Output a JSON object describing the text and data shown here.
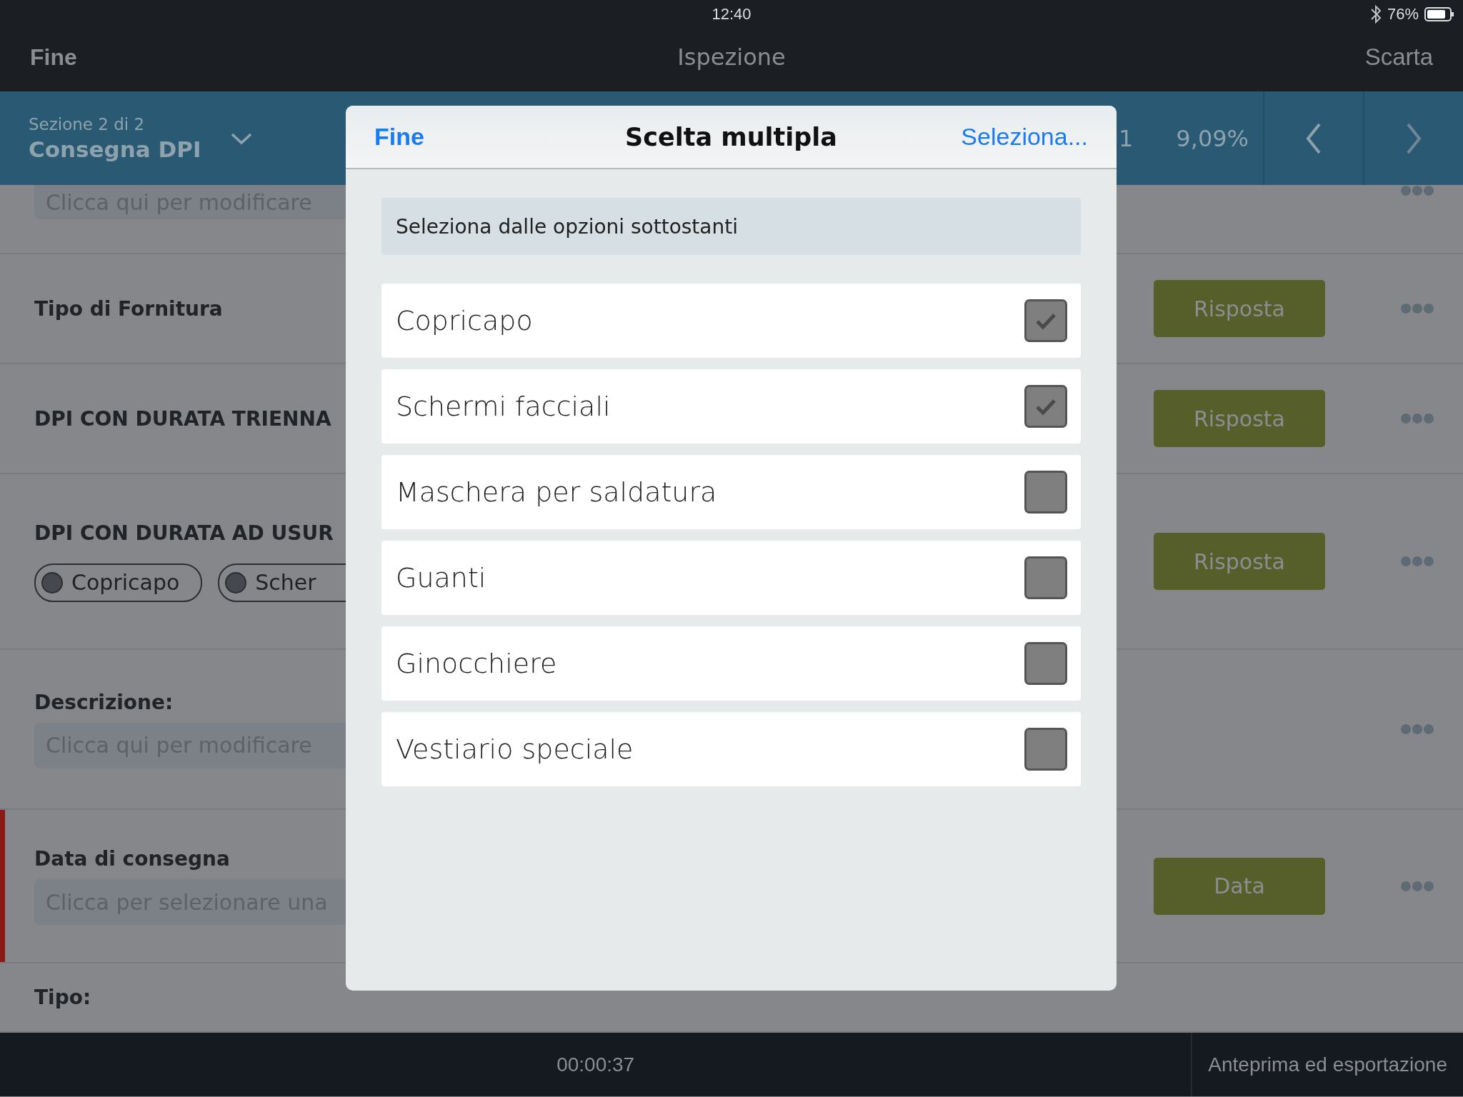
{
  "status_bar": {
    "time": "12:40",
    "battery": "76%"
  },
  "nav_bar": {
    "left": "Fine",
    "title": "Ispezione",
    "right": "Scarta"
  },
  "section_bar": {
    "subtitle": "Sezione 2 di 2",
    "title": "Consegna DPI",
    "counter": "1",
    "progress": "9,09%"
  },
  "questions": [
    {
      "kind": "field",
      "placeholder": "Clicca qui per modificare",
      "menu": true,
      "flagged": false
    },
    {
      "kind": "answer",
      "label": "Tipo di Fornitura",
      "button": "Risposta",
      "menu": true,
      "flagged": false
    },
    {
      "kind": "answer",
      "label": "DPI CON DURATA TRIENNA",
      "button": "Risposta",
      "menu": true,
      "flagged": false
    },
    {
      "kind": "chips",
      "label": "DPI CON DURATA AD USUR",
      "chips": [
        "Copricapo",
        "Scher"
      ],
      "button": "Risposta",
      "menu": true,
      "flagged": false
    },
    {
      "kind": "field",
      "label": "Descrizione:",
      "placeholder": "Clicca qui per modificare",
      "menu": true,
      "flagged": false
    },
    {
      "kind": "field",
      "label": "Data di consegna",
      "placeholder": "Clicca per selezionare una",
      "button": "Data",
      "menu": true,
      "flagged": true
    },
    {
      "kind": "answer",
      "label": "Tipo:",
      "menu": false,
      "flagged": false
    }
  ],
  "modal": {
    "left": "Fine",
    "title": "Scelta multipla",
    "right": "Seleziona...",
    "instruction": "Seleziona dalle opzioni sottostanti",
    "options": [
      {
        "label": "Copricapo",
        "checked": true
      },
      {
        "label": "Schermi facciali",
        "checked": true
      },
      {
        "label": "Maschera per saldatura",
        "checked": false
      },
      {
        "label": "Guanti",
        "checked": false
      },
      {
        "label": "Ginocchiere",
        "checked": false
      },
      {
        "label": "Vestiario speciale",
        "checked": false
      }
    ]
  },
  "bottom_bar": {
    "timer": "00:00:37",
    "action": "Anteprima ed esportazione"
  }
}
